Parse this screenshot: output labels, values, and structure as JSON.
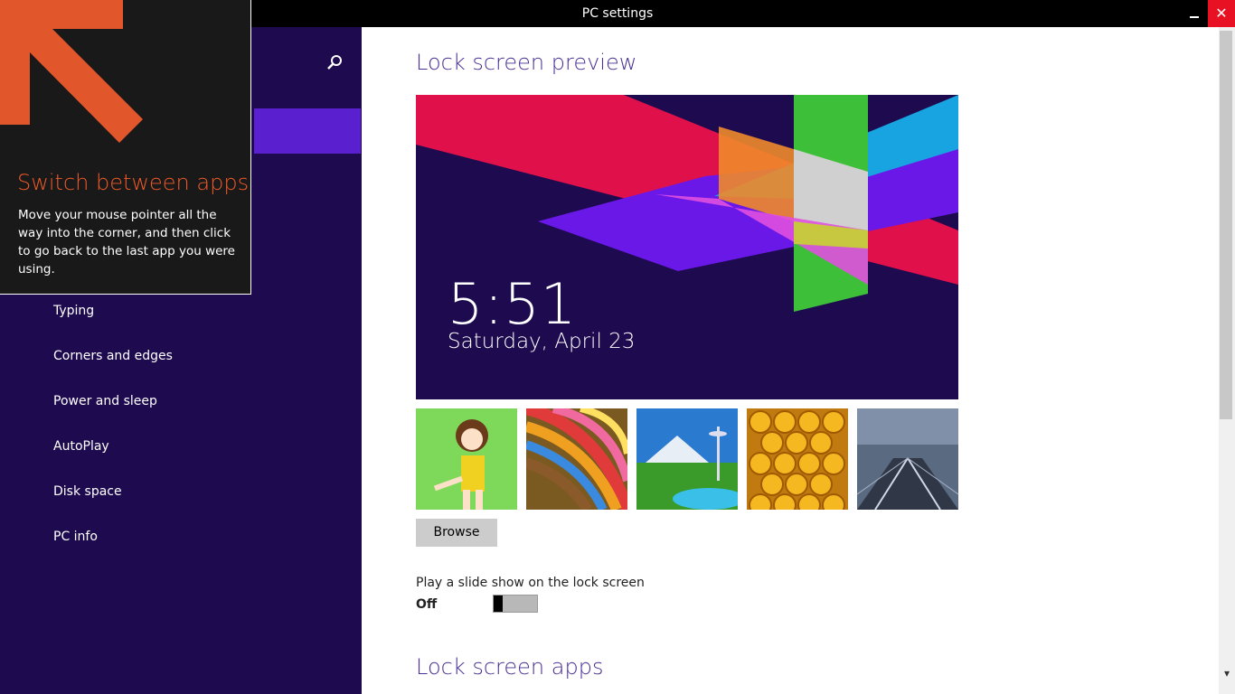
{
  "window": {
    "title": "PC settings",
    "close_label": "✕"
  },
  "sidebar": {
    "items": [
      {
        "label": "Typing"
      },
      {
        "label": "Corners and edges"
      },
      {
        "label": "Power and sleep"
      },
      {
        "label": "AutoPlay"
      },
      {
        "label": "Disk space"
      },
      {
        "label": "PC info"
      }
    ]
  },
  "tip": {
    "title": "Switch between apps",
    "body": "Move your mouse pointer all the way into the corner, and then click to go back to the last app you were using."
  },
  "main": {
    "preview_heading": "Lock screen preview",
    "preview": {
      "time": "5:51",
      "date": "Saturday, April 23"
    },
    "browse_label": "Browse",
    "slideshow_label": "Play a slide show on the lock screen",
    "slideshow_state": "Off",
    "apps_heading": "Lock screen apps"
  },
  "colors": {
    "accent": "#5a1fcf",
    "sidebar_bg": "#1d0a4f",
    "tip_title": "#f05a28",
    "heading": "#4a2f94"
  }
}
